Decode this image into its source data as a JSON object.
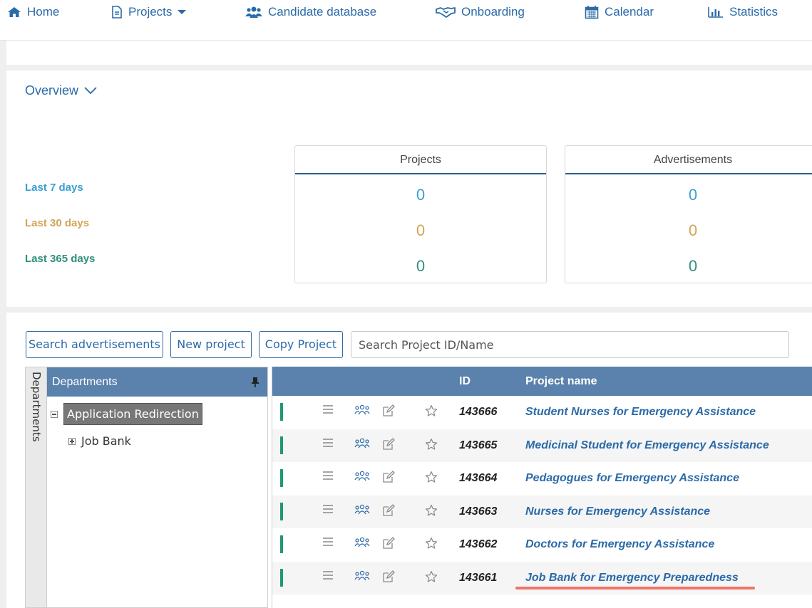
{
  "nav": {
    "home": "Home",
    "projects": "Projects",
    "candidate_database": "Candidate database",
    "onboarding": "Onboarding",
    "calendar": "Calendar",
    "statistics": "Statistics"
  },
  "overview": {
    "title": "Overview",
    "periods": [
      "Last 7 days",
      "Last 30 days",
      "Last 365 days"
    ],
    "cards": [
      {
        "title": "Projects",
        "values": [
          "0",
          "0",
          "0"
        ]
      },
      {
        "title": "Advertisements",
        "values": [
          "0",
          "0",
          "0"
        ]
      }
    ]
  },
  "toolbar": {
    "search_ads": "Search advertisements",
    "new_project": "New project",
    "copy_project": "Copy Project",
    "search_placeholder": "Search Project ID/Name"
  },
  "departments": {
    "tab_label": "Departments",
    "header": "Departments",
    "root": "Application Redirection",
    "child": "Job Bank"
  },
  "grid": {
    "col_id": "ID",
    "col_name": "Project name",
    "rows": [
      {
        "id": "143666",
        "name": "Student Nurses for Emergency Assistance"
      },
      {
        "id": "143665",
        "name": "Medicinal Student for Emergency Assistance"
      },
      {
        "id": "143664",
        "name": "Pedagogues for Emergency Assistance"
      },
      {
        "id": "143663",
        "name": "Nurses for Emergency Assistance"
      },
      {
        "id": "143662",
        "name": "Doctors for Emergency Assistance"
      },
      {
        "id": "143661",
        "name": "Job Bank for Emergency Preparedness"
      }
    ]
  },
  "colors": {
    "brand_blue": "#2b6aa8",
    "header_blue": "#5a82ac",
    "period_7": "#3a9ed1",
    "period_30": "#d4a457",
    "period_365": "#2f8f7a",
    "status_green": "#1f9a6e",
    "highlight_red": "#f0746a"
  }
}
